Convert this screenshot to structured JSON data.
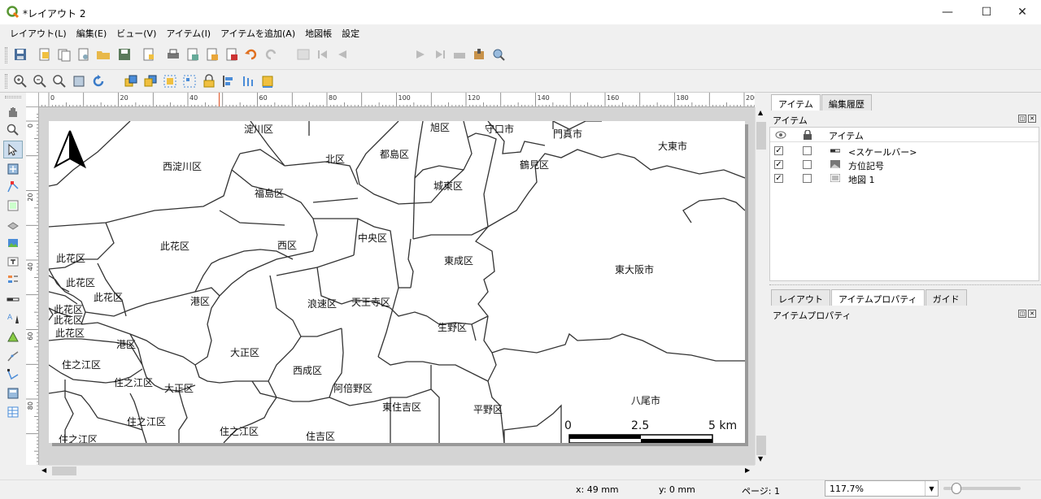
{
  "window": {
    "title": "*レイアウト 2",
    "minimize": "—",
    "maximize": "☐",
    "close": "✕"
  },
  "menu": [
    "レイアウト(L)",
    "編集(E)",
    "ビュー(V)",
    "アイテム(I)",
    "アイテムを追加(A)",
    "地図帳",
    "設定"
  ],
  "toolbar": {
    "page_value": "1"
  },
  "ruler": {
    "top_ticks": [
      "0",
      "20",
      "40",
      "60",
      "80",
      "100",
      "120",
      "140",
      "160",
      "180",
      "200"
    ],
    "left_ticks": [
      "0",
      "20",
      "40",
      "60",
      "80"
    ]
  },
  "map": {
    "wards": [
      {
        "name": "淀川区"
      },
      {
        "name": "旭区"
      },
      {
        "name": "守口市"
      },
      {
        "name": "門真市"
      },
      {
        "name": "西淀川区"
      },
      {
        "name": "北区"
      },
      {
        "name": "都島区"
      },
      {
        "name": "鶴見区"
      },
      {
        "name": "大東市"
      },
      {
        "name": "福島区"
      },
      {
        "name": "城東区"
      },
      {
        "name": "此花区"
      },
      {
        "name": "西区"
      },
      {
        "name": "中央区"
      },
      {
        "name": "此花区"
      },
      {
        "name": "東成区"
      },
      {
        "name": "東大阪市"
      },
      {
        "name": "此花区"
      },
      {
        "name": "此花区"
      },
      {
        "name": "港区"
      },
      {
        "name": "浪速区"
      },
      {
        "name": "天王寺区"
      },
      {
        "name": "此花区"
      },
      {
        "name": "此花区"
      },
      {
        "name": "此花区"
      },
      {
        "name": "生野区"
      },
      {
        "name": "港区"
      },
      {
        "name": "大正区"
      },
      {
        "name": "住之江区"
      },
      {
        "name": "西成区"
      },
      {
        "name": "住之江区"
      },
      {
        "name": "大正区"
      },
      {
        "name": "阿倍野区"
      },
      {
        "name": "八尾市"
      },
      {
        "name": "東住吉区"
      },
      {
        "name": "平野区"
      },
      {
        "name": "住之江区"
      },
      {
        "name": "住之江区"
      },
      {
        "name": "住吉区"
      },
      {
        "name": "住之江区"
      }
    ],
    "scalebar": {
      "labels": [
        "0",
        "2.5",
        "5 km"
      ]
    }
  },
  "right_panel": {
    "top_tabs": [
      "アイテム",
      "編集履歴"
    ],
    "items_title": "アイテム",
    "items_column": "アイテム",
    "items": [
      {
        "label": "<スケールバー>",
        "visible": true,
        "locked": false
      },
      {
        "label": "方位記号",
        "visible": true,
        "locked": false
      },
      {
        "label": "地図 1",
        "visible": true,
        "locked": false
      }
    ],
    "bottom_tabs": [
      "レイアウト",
      "アイテムプロパティ",
      "ガイド"
    ],
    "props_title": "アイテムプロパティ"
  },
  "status": {
    "x": "x: 49 mm",
    "y": "y: 0 mm",
    "page": "ページ: 1",
    "zoom": "117.7%"
  }
}
